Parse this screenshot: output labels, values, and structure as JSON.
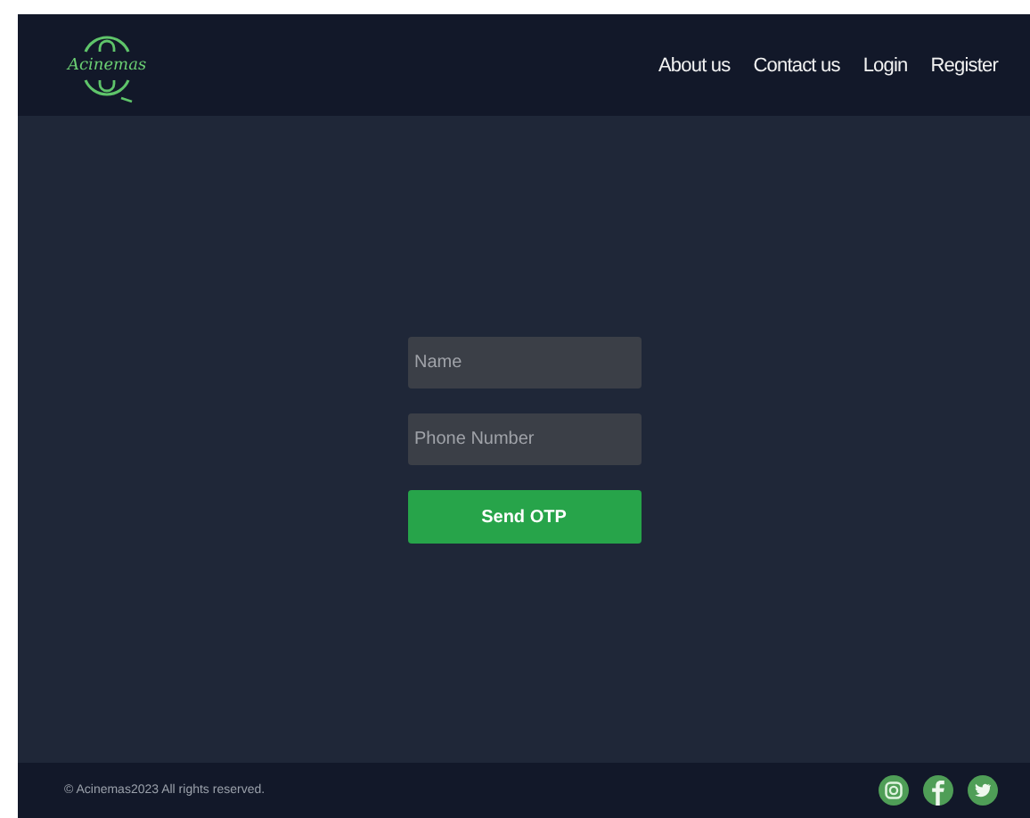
{
  "header": {
    "logo_text": "Acinemas",
    "nav": [
      {
        "label": "About us"
      },
      {
        "label": "Contact us"
      },
      {
        "label": "Login"
      },
      {
        "label": "Register"
      }
    ]
  },
  "form": {
    "fields": [
      {
        "placeholder": "Name"
      },
      {
        "placeholder": "Phone Number"
      }
    ],
    "button": "Send OTP"
  },
  "footer": {
    "copyright": "© Acinemas2023 All rights reserved.",
    "social": [
      {
        "kind": "instagram"
      },
      {
        "kind": "facebook"
      },
      {
        "kind": "twitter"
      }
    ]
  }
}
